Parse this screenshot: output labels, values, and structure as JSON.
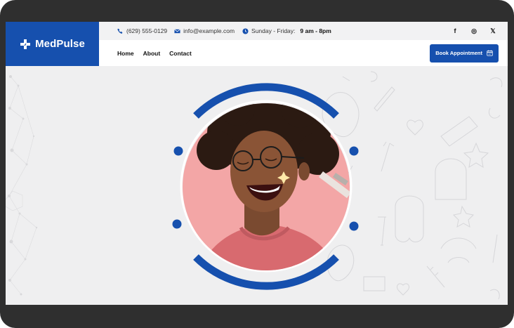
{
  "brand": {
    "name": "MedPulse",
    "color": "#1650ae"
  },
  "topbar": {
    "phone": "(629) 555-0129",
    "email": "info@example.com",
    "hours_prefix": "Sunday - Friday:",
    "hours_value": "9 am - 8pm",
    "socials": [
      {
        "icon": "facebook-icon",
        "glyph": "f"
      },
      {
        "icon": "instagram-icon",
        "glyph": "◎"
      },
      {
        "icon": "x-icon",
        "glyph": "𝕏"
      }
    ]
  },
  "nav": {
    "items": [
      "Home",
      "About",
      "Contact"
    ],
    "cta": "Book Appointment"
  },
  "colors": {
    "accent": "#1650ae",
    "portrait_bg": "#f3a6a6",
    "sweater": "#d86a6f",
    "skin": "#8a5436"
  }
}
